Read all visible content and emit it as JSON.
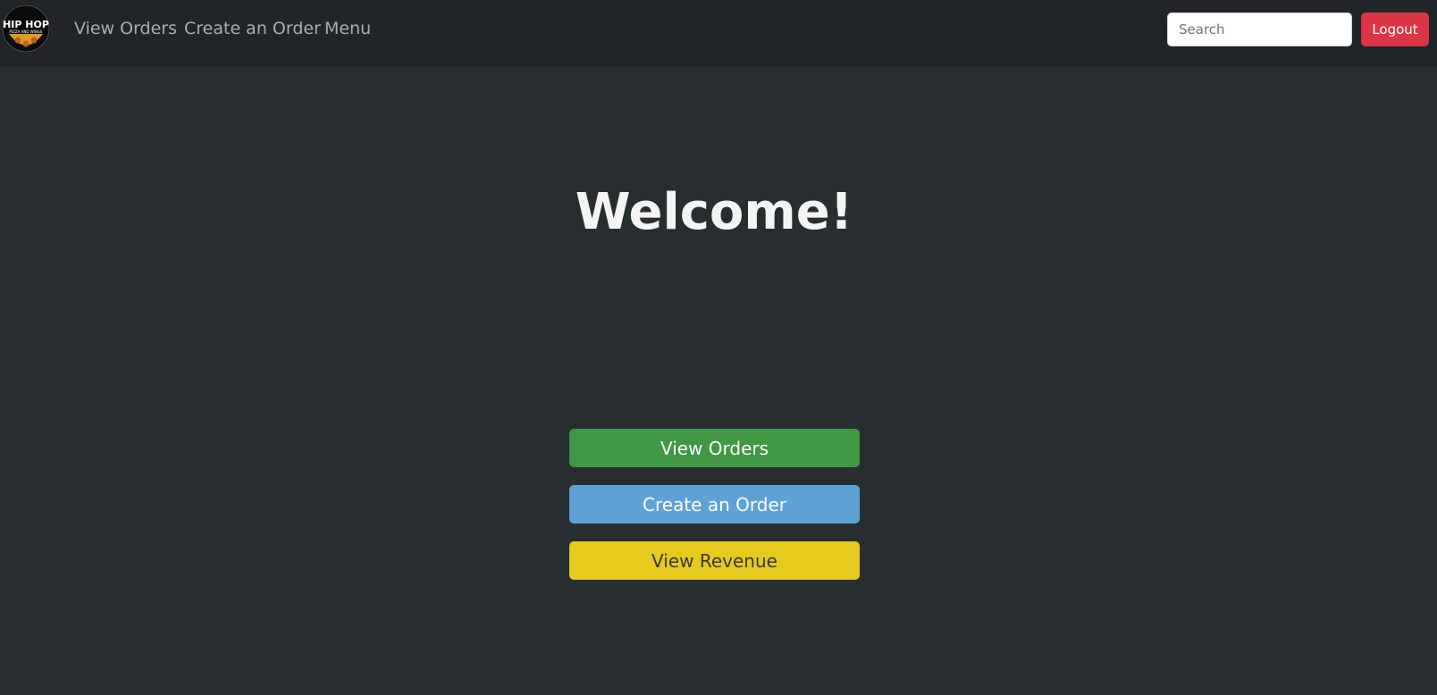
{
  "navbar": {
    "logo": {
      "icon": "hip-hop-pizza-logo-icon",
      "text_top": "HIP HOP",
      "text_bottom": "PIZZA AND WINGS"
    },
    "links": [
      {
        "label": "View Orders"
      },
      {
        "label": "Create an Order"
      },
      {
        "label": "Menu"
      }
    ],
    "search": {
      "placeholder": "Search",
      "value": ""
    },
    "logout_label": "Logout"
  },
  "main": {
    "heading": "Welcome!",
    "buttons": [
      {
        "label": "View Orders",
        "color": "#409744"
      },
      {
        "label": "Create an Order",
        "color": "#5ea2d5"
      },
      {
        "label": "View Revenue",
        "color": "#e6ca1d"
      }
    ]
  },
  "colors": {
    "background": "#282e2f",
    "navbar": "#212529",
    "logout": "#dc3545"
  }
}
